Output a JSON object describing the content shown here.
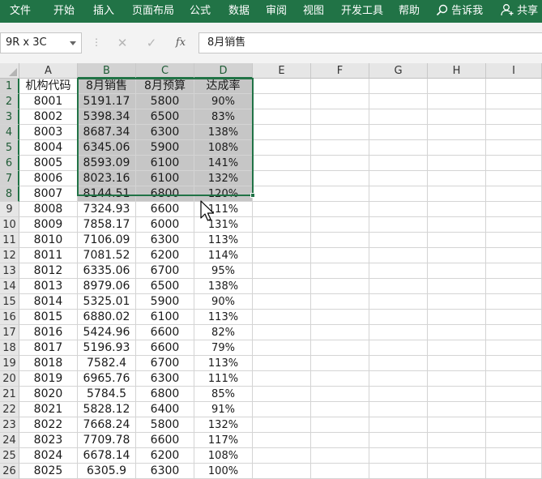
{
  "ribbon": {
    "tabs": [
      "文件",
      "开始",
      "插入",
      "页面布局",
      "公式",
      "数据",
      "审阅",
      "视图",
      "开发工具",
      "帮助"
    ],
    "tell_me": "告诉我",
    "share": "共享"
  },
  "formula_bar": {
    "name_box": "9R x 3C",
    "content": "8月销售",
    "fx_label": "fx"
  },
  "columns": [
    "A",
    "B",
    "C",
    "D",
    "E",
    "F",
    "G",
    "H",
    "I"
  ],
  "selection": {
    "columns": [
      "B",
      "C",
      "D"
    ],
    "rows": [
      1,
      2,
      3,
      4,
      5,
      6,
      7,
      8
    ]
  },
  "rows": [
    {
      "num": "1",
      "cells": [
        "机构代码",
        "8月销售",
        "8月预算",
        "达成率"
      ]
    },
    {
      "num": "2",
      "cells": [
        "8001",
        "5191.17",
        "5800",
        "90%"
      ]
    },
    {
      "num": "3",
      "cells": [
        "8002",
        "5398.34",
        "6500",
        "83%"
      ]
    },
    {
      "num": "4",
      "cells": [
        "8003",
        "8687.34",
        "6300",
        "138%"
      ]
    },
    {
      "num": "5",
      "cells": [
        "8004",
        "6345.06",
        "5900",
        "108%"
      ]
    },
    {
      "num": "6",
      "cells": [
        "8005",
        "8593.09",
        "6100",
        "141%"
      ]
    },
    {
      "num": "7",
      "cells": [
        "8006",
        "8023.16",
        "6100",
        "132%"
      ]
    },
    {
      "num": "8",
      "cells": [
        "8007",
        "8144.51",
        "6800",
        "120%"
      ]
    },
    {
      "num": "9",
      "cells": [
        "8008",
        "7324.93",
        "6600",
        "111%"
      ]
    },
    {
      "num": "10",
      "cells": [
        "8009",
        "7858.17",
        "6000",
        "131%"
      ]
    },
    {
      "num": "11",
      "cells": [
        "8010",
        "7106.09",
        "6300",
        "113%"
      ]
    },
    {
      "num": "12",
      "cells": [
        "8011",
        "7081.52",
        "6200",
        "114%"
      ]
    },
    {
      "num": "13",
      "cells": [
        "8012",
        "6335.06",
        "6700",
        "95%"
      ]
    },
    {
      "num": "14",
      "cells": [
        "8013",
        "8979.06",
        "6500",
        "138%"
      ]
    },
    {
      "num": "15",
      "cells": [
        "8014",
        "5325.01",
        "5900",
        "90%"
      ]
    },
    {
      "num": "16",
      "cells": [
        "8015",
        "6880.02",
        "6100",
        "113%"
      ]
    },
    {
      "num": "17",
      "cells": [
        "8016",
        "5424.96",
        "6600",
        "82%"
      ]
    },
    {
      "num": "18",
      "cells": [
        "8017",
        "5196.93",
        "6600",
        "79%"
      ]
    },
    {
      "num": "19",
      "cells": [
        "8018",
        "7582.4",
        "6700",
        "113%"
      ]
    },
    {
      "num": "20",
      "cells": [
        "8019",
        "6965.76",
        "6300",
        "111%"
      ]
    },
    {
      "num": "21",
      "cells": [
        "8020",
        "5784.5",
        "6800",
        "85%"
      ]
    },
    {
      "num": "22",
      "cells": [
        "8021",
        "5828.12",
        "6400",
        "91%"
      ]
    },
    {
      "num": "23",
      "cells": [
        "8022",
        "7668.24",
        "5800",
        "132%"
      ]
    },
    {
      "num": "24",
      "cells": [
        "8023",
        "7709.78",
        "6600",
        "117%"
      ]
    },
    {
      "num": "25",
      "cells": [
        "8024",
        "6678.14",
        "6200",
        "108%"
      ]
    },
    {
      "num": "26",
      "cells": [
        "8025",
        "6305.9",
        "6300",
        "100%"
      ]
    }
  ]
}
